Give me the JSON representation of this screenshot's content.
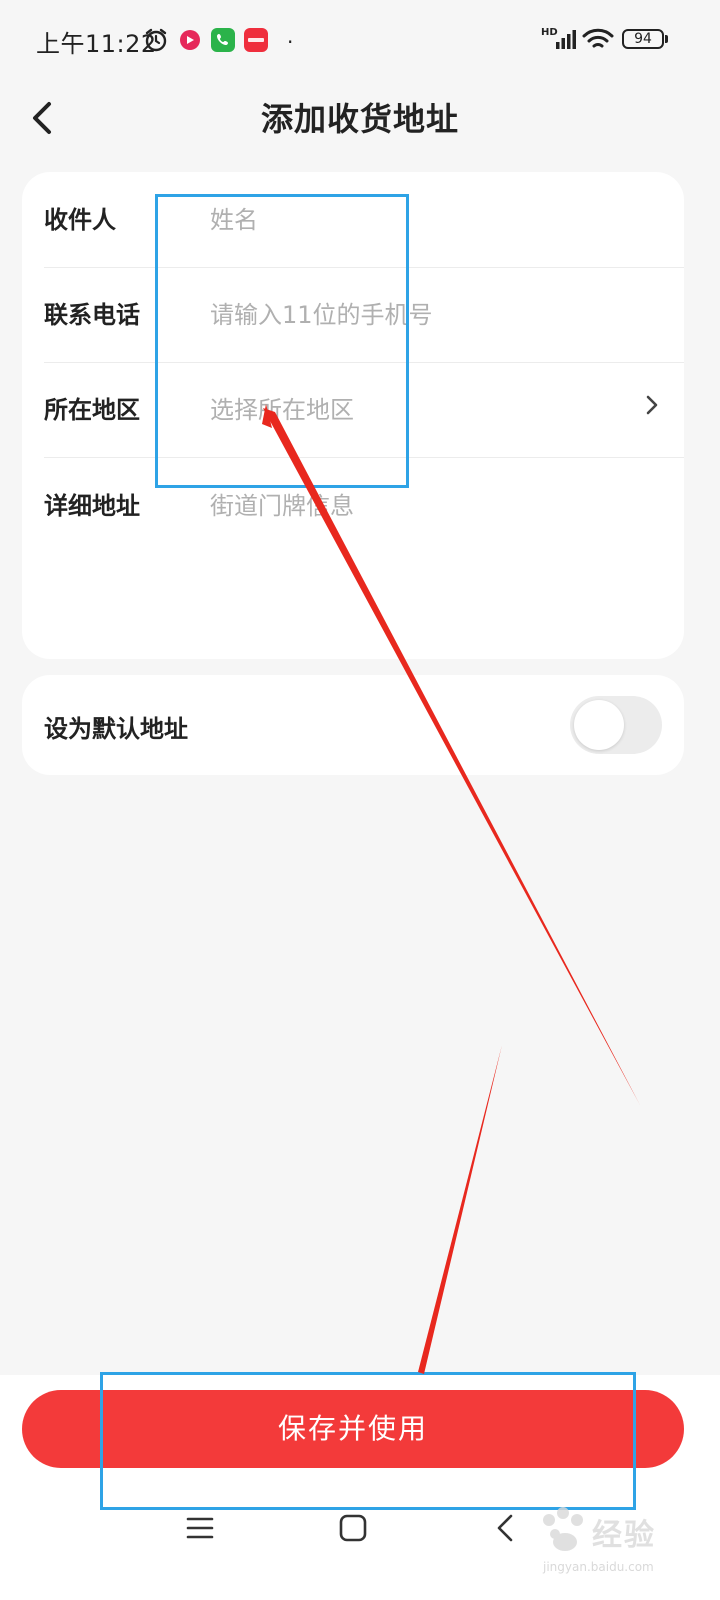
{
  "status_bar": {
    "time": "上午11:22",
    "network": "HD",
    "battery": "94",
    "icons": [
      "alarm-icon",
      "app-icon-1",
      "phone-app-icon",
      "xiaohongshu-app-icon",
      "signal-icon",
      "wifi-icon",
      "battery-icon"
    ]
  },
  "nav": {
    "title": "添加收货地址",
    "back_icon": "chevron-left-icon"
  },
  "form": {
    "name": {
      "label": "收件人",
      "placeholder": "姓名",
      "value": ""
    },
    "phone": {
      "label": "联系电话",
      "placeholder": "请输入11位的手机号",
      "value": ""
    },
    "region": {
      "label": "所在地区",
      "placeholder": "选择所在地区",
      "value": ""
    },
    "detail": {
      "label": "详细地址",
      "placeholder": "街道门牌信息",
      "value": ""
    }
  },
  "default_address": {
    "label": "设为默认地址",
    "enabled": false
  },
  "actions": {
    "save_label": "保存并使用"
  },
  "system_nav": [
    "menu-icon",
    "home-icon",
    "back-icon"
  ],
  "watermark": {
    "text": "经验",
    "url": "jingyan.baidu.com"
  },
  "colors": {
    "accent": "#f33a3a",
    "annotation_box": "#2ea3e6",
    "annotation_arrow": "#e8281e",
    "background": "#f6f6f6",
    "placeholder": "#b0b0b0"
  }
}
